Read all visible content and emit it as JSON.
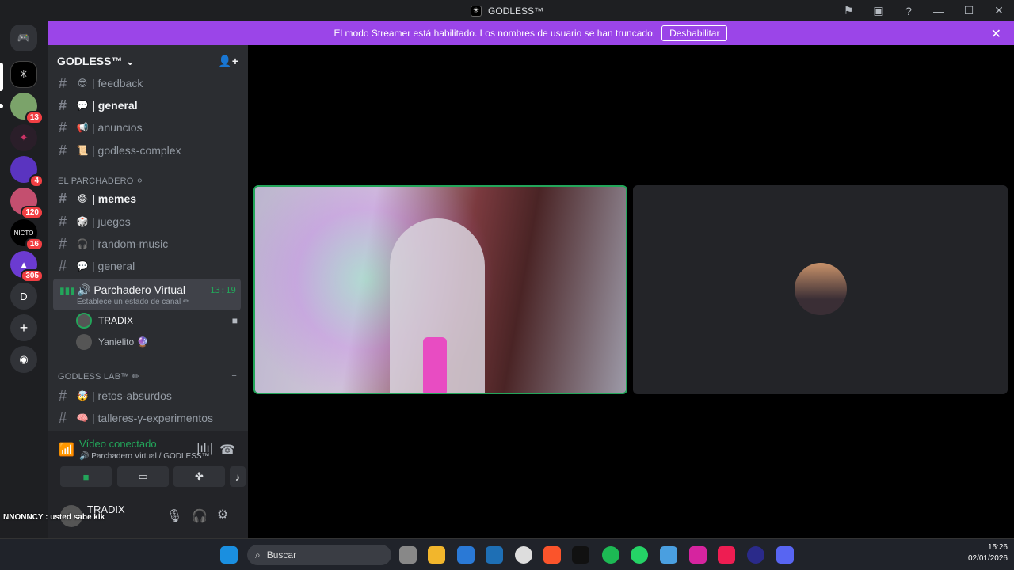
{
  "window": {
    "title": "GODLESS™"
  },
  "banner": {
    "text": "El modo Streamer está habilitado. Los nombres de usuario se han truncado.",
    "button": "Deshabilitar"
  },
  "server": {
    "name": "GODLESS™ ⌄"
  },
  "guild_badges": [
    "13",
    "4",
    "120",
    "16",
    "305"
  ],
  "guild_letter": "D",
  "channels_top": [
    {
      "emoji": "😎",
      "name": "| feedback",
      "unread": false
    },
    {
      "emoji": "💬",
      "name": "| general",
      "unread": true
    },
    {
      "emoji": "📢",
      "name": "| anuncios",
      "unread": false
    },
    {
      "emoji": "📜",
      "name": "| godless-complex",
      "unread": false
    }
  ],
  "category1": "EL PARCHADERO ⚪",
  "channels_mid": [
    {
      "emoji": "😂",
      "name": "| memes",
      "unread": true
    },
    {
      "emoji": "🎲",
      "name": "| juegos",
      "unread": false
    },
    {
      "emoji": "🎧",
      "name": "| random-music",
      "unread": false
    },
    {
      "emoji": "💬",
      "name": "| general",
      "unread": false
    }
  ],
  "voice": {
    "name": "🔊 Parchadero Virtual",
    "time": "13:19",
    "status": "Establece un estado de canal ✏"
  },
  "voice_users": [
    "TRADIX",
    "Yanielito 🔮"
  ],
  "category2": "GODLESS LAB™ ✏",
  "channels_lab": [
    {
      "emoji": "🤯",
      "name": "| retos-absurdos"
    },
    {
      "emoji": "🧠",
      "name": "| talleres-y-experimentos"
    }
  ],
  "connection": {
    "title": "Vídeo conectado",
    "sub": "🔊 Parchadero Virtual / GODLESS™"
  },
  "user": {
    "name": "TRADIX"
  },
  "overlay_text": "NNONNCY : usted sabe klk",
  "taskbar": {
    "search": "Buscar",
    "time": "15:26",
    "date": "02/01/2026"
  }
}
